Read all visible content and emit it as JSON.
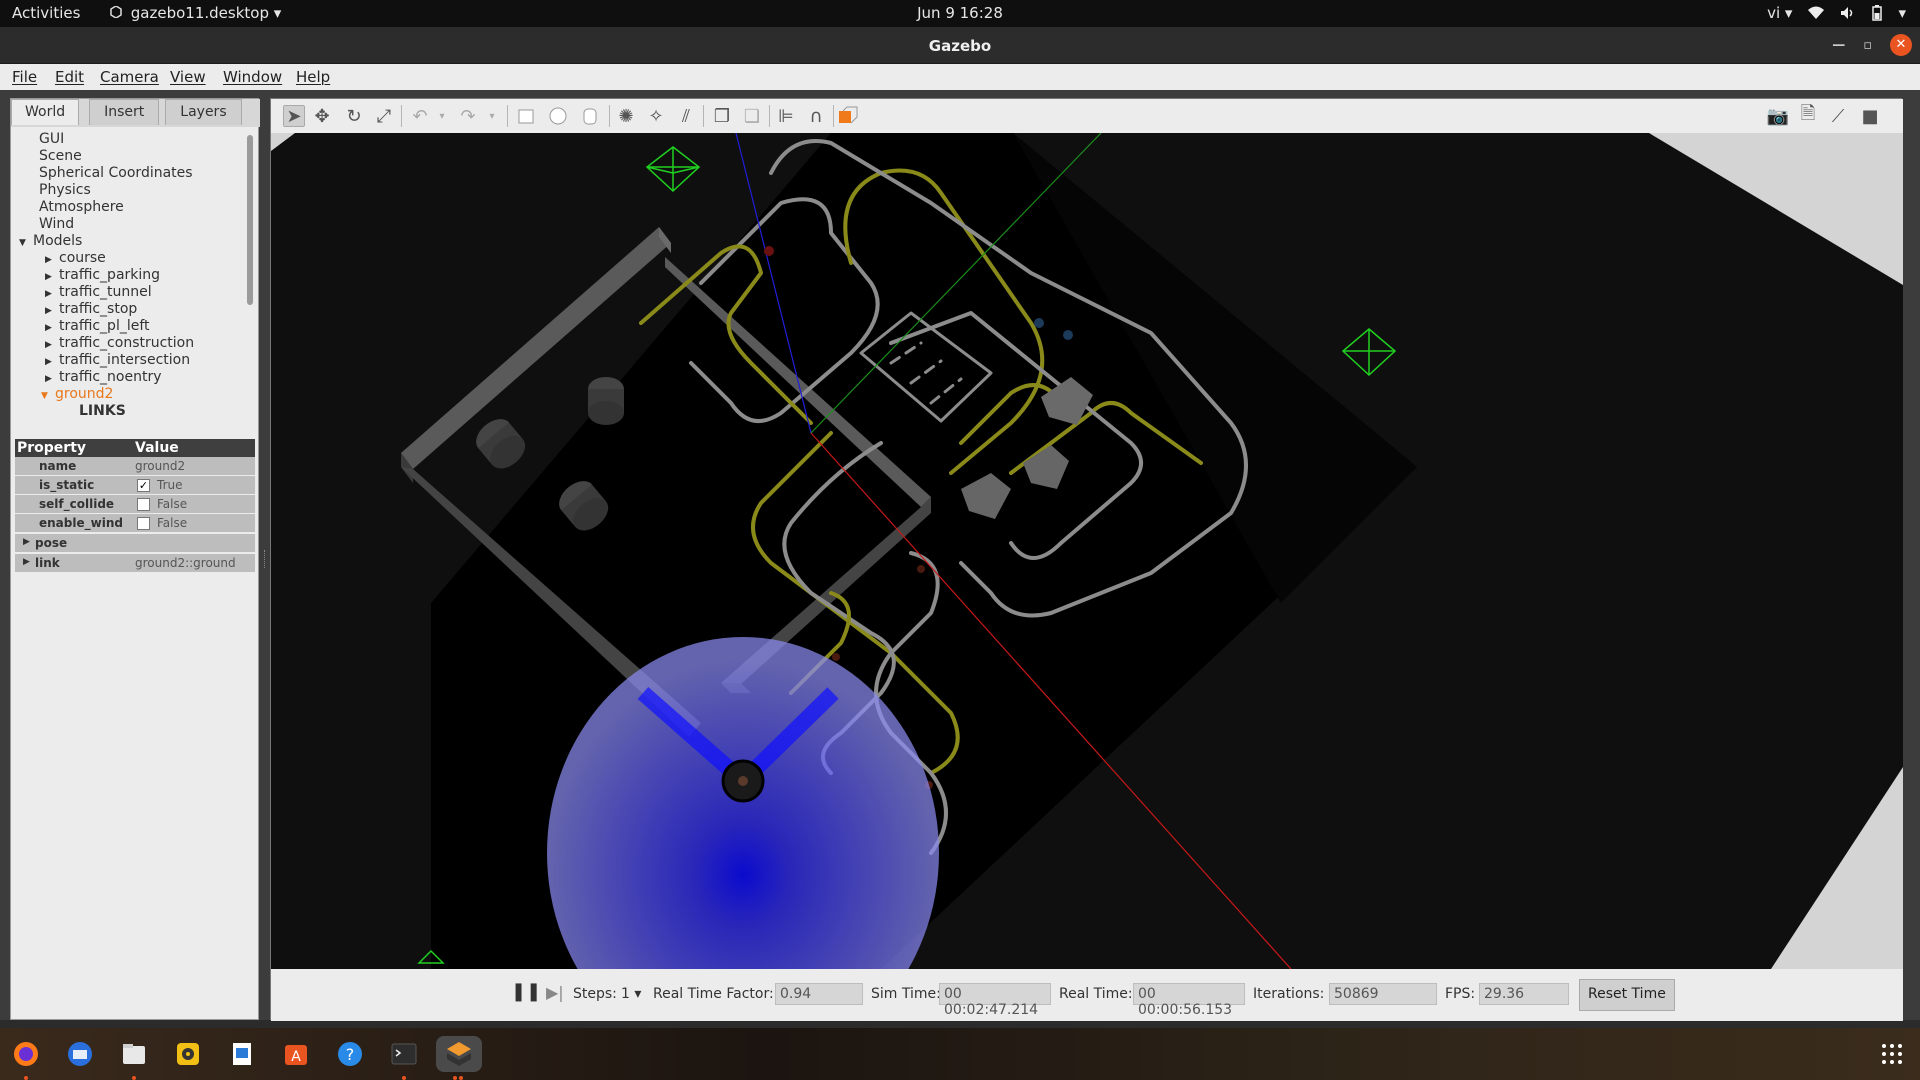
{
  "topbar": {
    "activities": "Activities",
    "app_name": "gazebo11.desktop",
    "clock": "Jun 9  16:28",
    "lang": "vi"
  },
  "window": {
    "title": "Gazebo"
  },
  "menu": [
    "File",
    "Edit",
    "Camera",
    "View",
    "Window",
    "Help"
  ],
  "left_tabs": [
    "World",
    "Insert",
    "Layers"
  ],
  "tree": {
    "top_items": [
      "GUI",
      "Scene",
      "Spherical Coordinates",
      "Physics",
      "Atmosphere",
      "Wind"
    ],
    "models_label": "Models",
    "models": [
      "course",
      "traffic_parking",
      "traffic_tunnel",
      "traffic_stop",
      "traffic_pl_left",
      "traffic_construction",
      "traffic_intersection",
      "traffic_noentry"
    ],
    "selected_model": "ground2",
    "links_label": "LINKS"
  },
  "properties": {
    "header_property": "Property",
    "header_value": "Value",
    "rows": [
      {
        "name": "name",
        "value": "ground2"
      },
      {
        "name": "is_static",
        "value": "True",
        "checked": true
      },
      {
        "name": "self_collide",
        "value": "False",
        "checked": false
      },
      {
        "name": "enable_wind",
        "value": "False",
        "checked": false
      }
    ],
    "pose_label": "pose",
    "link_label": "link",
    "link_value": "ground2::ground"
  },
  "bottombar": {
    "steps_label": "Steps:",
    "steps_value": "1",
    "rtf_label": "Real Time Factor:",
    "rtf_value": "0.94",
    "sim_time_label": "Sim Time:",
    "sim_time_value": "00 00:02:47.214",
    "real_time_label": "Real Time:",
    "real_time_value": "00 00:00:56.153",
    "iterations_label": "Iterations:",
    "iterations_value": "50869",
    "fps_label": "FPS:",
    "fps_value": "29.36",
    "reset_label": "Reset Time"
  },
  "colors": {
    "accent": "#e95420",
    "selected_model": "#e8781c",
    "laser": "#3a36ff",
    "track_yellow": "#8a8a1a",
    "track_white": "#9a9a9a"
  }
}
